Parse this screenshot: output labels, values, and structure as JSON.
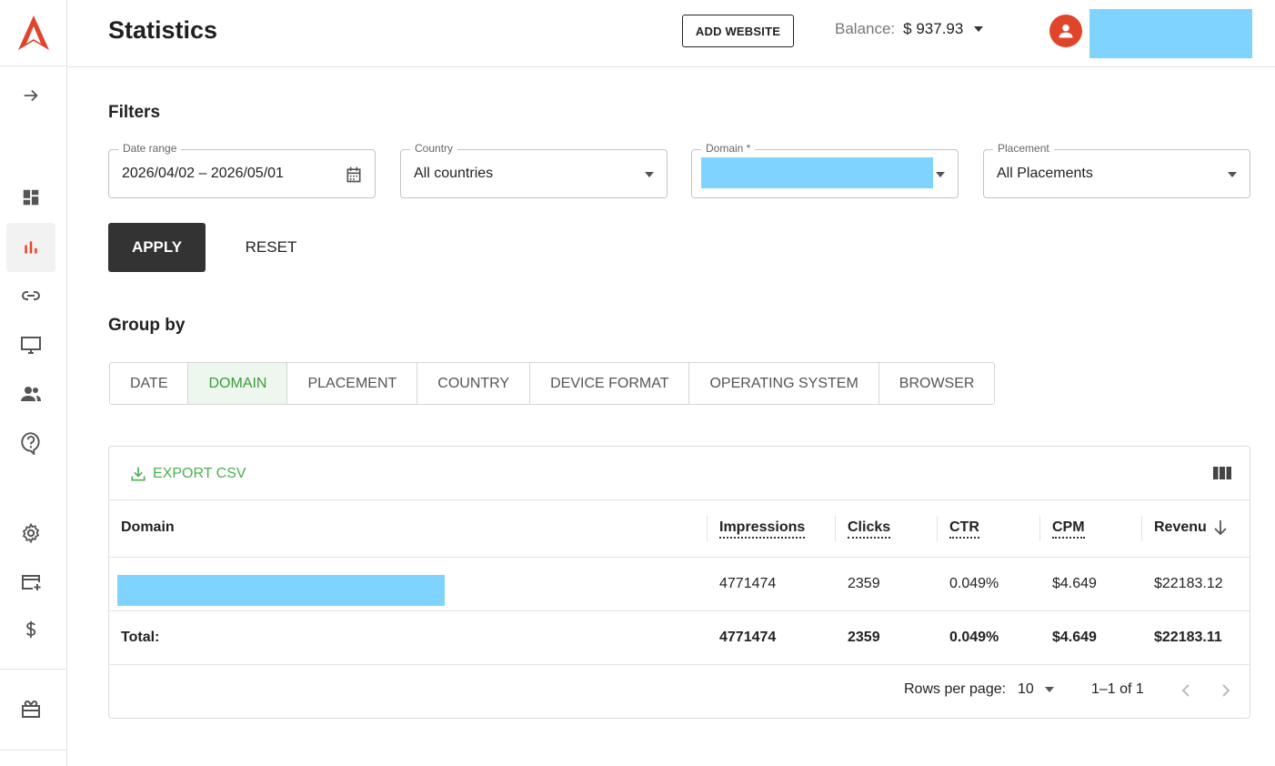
{
  "header": {
    "title": "Statistics",
    "add_website": "ADD WEBSITE",
    "balance_label": "Balance:",
    "balance_value": "$ 937.93"
  },
  "sidebar": {
    "items": [
      {
        "icon": "arrow-right-icon"
      },
      {
        "icon": "dashboard-icon"
      },
      {
        "icon": "bar-chart-icon",
        "active": true
      },
      {
        "icon": "link-icon"
      },
      {
        "icon": "monitor-icon"
      },
      {
        "icon": "users-icon"
      },
      {
        "icon": "help-icon"
      },
      {
        "icon": "gear-icon"
      },
      {
        "icon": "add-card-icon"
      },
      {
        "icon": "dollar-icon"
      },
      {
        "icon": "gift-icon"
      }
    ]
  },
  "filters": {
    "title": "Filters",
    "date_range": {
      "label": "Date range",
      "value": "2026/04/02 – 2026/05/01"
    },
    "country": {
      "label": "Country",
      "value": "All countries"
    },
    "domain": {
      "label": "Domain *",
      "value": ""
    },
    "placement": {
      "label": "Placement",
      "value": "All Placements"
    },
    "apply": "APPLY",
    "reset": "RESET"
  },
  "group_by": {
    "title": "Group by",
    "tabs": [
      "DATE",
      "DOMAIN",
      "PLACEMENT",
      "COUNTRY",
      "DEVICE FORMAT",
      "OPERATING SYSTEM",
      "BROWSER"
    ],
    "active": "DOMAIN"
  },
  "table": {
    "export_label": "EXPORT CSV",
    "columns": [
      "Domain",
      "Impressions",
      "Clicks",
      "CTR",
      "CPM",
      "Revenu"
    ],
    "rows": [
      {
        "domain": "",
        "impressions": "4771474",
        "clicks": "2359",
        "ctr": "0.049%",
        "cpm": "$4.649",
        "revenue": "$22183.12"
      }
    ],
    "total": {
      "label": "Total:",
      "impressions": "4771474",
      "clicks": "2359",
      "ctr": "0.049%",
      "cpm": "$4.649",
      "revenue": "$22183.11"
    },
    "pagination": {
      "rows_per_page_label": "Rows per page:",
      "rows_per_page": "10",
      "range": "1–1 of 1"
    }
  },
  "colors": {
    "accent": "#e0452c",
    "active_tab": "#3d9b3d",
    "redaction": "#7fd4ff"
  }
}
